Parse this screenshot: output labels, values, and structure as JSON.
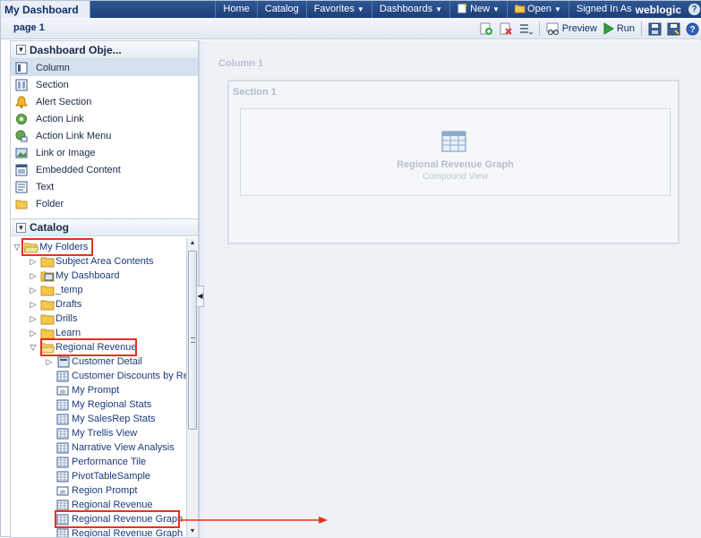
{
  "app": {
    "title": "My Dashboard"
  },
  "topnav": {
    "home": "Home",
    "catalog": "Catalog",
    "favorites": "Favorites",
    "dashboards": "Dashboards",
    "new": "New",
    "open": "Open",
    "signed_in_as": "Signed In As",
    "user": "weblogic",
    "help": "?"
  },
  "pagebar": {
    "page_tab": "page 1",
    "preview": "Preview",
    "run": "Run"
  },
  "dashboard_objects": {
    "title": "Dashboard Obje...",
    "items": [
      {
        "label": "Column",
        "icon": "column-icon"
      },
      {
        "label": "Section",
        "icon": "section-icon"
      },
      {
        "label": "Alert Section",
        "icon": "alert-bell-icon"
      },
      {
        "label": "Action Link",
        "icon": "action-link-icon"
      },
      {
        "label": "Action Link Menu",
        "icon": "action-link-menu-icon"
      },
      {
        "label": "Link or Image",
        "icon": "link-image-icon"
      },
      {
        "label": "Embedded Content",
        "icon": "embedded-content-icon"
      },
      {
        "label": "Text",
        "icon": "text-icon"
      },
      {
        "label": "Folder",
        "icon": "folder-icon"
      }
    ]
  },
  "catalog": {
    "title": "Catalog",
    "tree": [
      {
        "label": "My Folders",
        "icon": "open-folder-icon"
      },
      {
        "label": "Subject Area Contents",
        "icon": "folder-icon"
      },
      {
        "label": "My Dashboard",
        "icon": "dashboard-icon"
      },
      {
        "label": "_temp",
        "icon": "folder-icon"
      },
      {
        "label": "Drafts",
        "icon": "folder-icon"
      },
      {
        "label": "Drills",
        "icon": "folder-icon"
      },
      {
        "label": "Learn",
        "icon": "folder-icon"
      },
      {
        "label": "Regional Revenue",
        "icon": "open-folder-icon"
      },
      {
        "label": "Customer Detail",
        "icon": "dashboard-icon"
      },
      {
        "label": "Customer Discounts by Reg",
        "icon": "analysis-icon"
      },
      {
        "label": "My Prompt",
        "icon": "prompt-icon"
      },
      {
        "label": "My Regional Stats",
        "icon": "analysis-icon"
      },
      {
        "label": "My SalesRep Stats",
        "icon": "analysis-icon"
      },
      {
        "label": "My Trellis View",
        "icon": "analysis-icon"
      },
      {
        "label": "Narrative View Analysis",
        "icon": "analysis-icon"
      },
      {
        "label": "Performance Tile",
        "icon": "analysis-icon"
      },
      {
        "label": "PivotTableSample",
        "icon": "analysis-icon"
      },
      {
        "label": "Region Prompt",
        "icon": "prompt-icon"
      },
      {
        "label": "Regional Revenue",
        "icon": "analysis-icon"
      },
      {
        "label": "Regional Revenue Graph",
        "icon": "analysis-icon"
      },
      {
        "label": "Regional Revenue Graph N",
        "icon": "analysis-icon"
      }
    ]
  },
  "canvas": {
    "column_label": "Column 1",
    "section_label": "Section 1",
    "view_title": "Regional Revenue Graph",
    "view_subtitle": "Compound View"
  },
  "colors": {
    "topbar": "#1d3f78",
    "highlight": "#e8321c",
    "folder": "#f4c84a",
    "run_green": "#2fa23a"
  }
}
